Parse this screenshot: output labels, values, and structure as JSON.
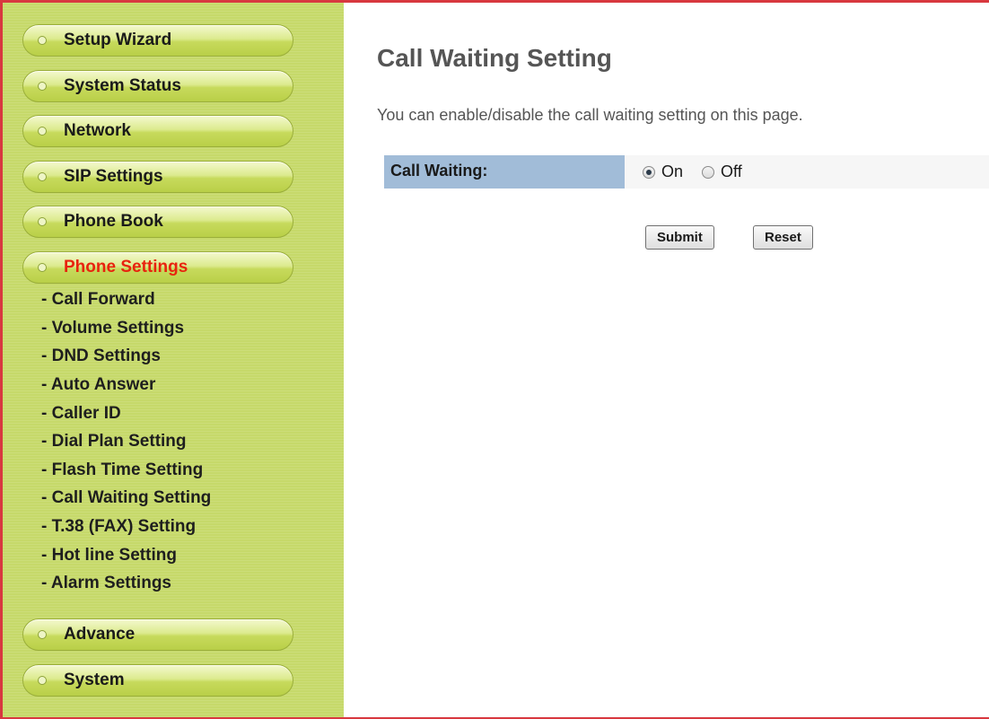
{
  "sidebar": {
    "menu_top": [
      {
        "label": "Setup Wizard"
      },
      {
        "label": "System Status"
      },
      {
        "label": "Network"
      },
      {
        "label": "SIP Settings"
      },
      {
        "label": "Phone Book"
      },
      {
        "label": "Phone Settings",
        "active": true
      }
    ],
    "submenu": [
      {
        "label": "- Call Forward"
      },
      {
        "label": "- Volume Settings"
      },
      {
        "label": "- DND Settings"
      },
      {
        "label": "- Auto Answer"
      },
      {
        "label": "- Caller ID"
      },
      {
        "label": "- Dial Plan Setting"
      },
      {
        "label": "- Flash Time Setting"
      },
      {
        "label": "- Call Waiting Setting"
      },
      {
        "label": "- T.38 (FAX) Setting"
      },
      {
        "label": "- Hot line Setting"
      },
      {
        "label": "- Alarm Settings"
      }
    ],
    "menu_bottom": [
      {
        "label": "Advance"
      },
      {
        "label": "System"
      }
    ]
  },
  "main": {
    "title": "Call Waiting Setting",
    "description": "You can enable/disable the call waiting setting on this page.",
    "field": {
      "label": "Call Waiting:",
      "options": [
        "On",
        "Off"
      ],
      "selected": "On"
    },
    "buttons": {
      "submit": "Submit",
      "reset": "Reset"
    }
  },
  "colors": {
    "sidebar_bg": "#c6d96a",
    "active_menu_text": "#e8230e",
    "field_label_bg": "#a1bcd8",
    "frame_border": "#d8383f"
  },
  "icons": {
    "menu_bullet": "circle-bullet-icon",
    "radio": "radio-icon"
  }
}
